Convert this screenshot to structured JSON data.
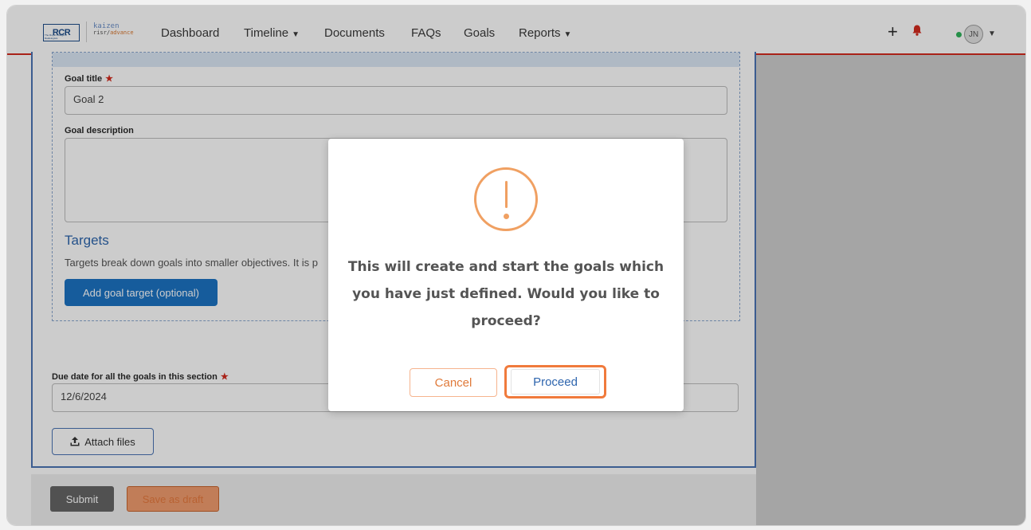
{
  "navbar": {
    "logo_rcr": "RCR",
    "logo_rcr_sub": "The Royal College of Radiologists",
    "logo_kaizen": "kaizen",
    "logo_risr": "risr/",
    "logo_advance": "advance",
    "links": [
      "Dashboard",
      "Timeline",
      "Documents",
      "FAQs",
      "Goals",
      "Reports"
    ],
    "avatar_initials": "JN",
    "accent_color": "#d42b1e"
  },
  "form": {
    "goal_title_label": "Goal title",
    "goal_title_value": "Goal 2",
    "goal_description_label": "Goal description",
    "goal_description_value": "",
    "targets_title": "Targets",
    "targets_description": "Targets break down goals into smaller objectives. It is p",
    "add_target_button": "Add goal target (optional)",
    "due_date_label": "Due date for all the goals in this section",
    "due_date_value": "12/6/2024",
    "attach_files_button": "Attach files",
    "submit_button": "Submit",
    "save_draft_button": "Save as draft"
  },
  "modal": {
    "message": "This will create and start the goals which you have just defined. Would you like to proceed?",
    "cancel_button": "Cancel",
    "proceed_button": "Proceed",
    "icon": "exclamation-circle-icon",
    "accent_color": "#f0a062"
  }
}
